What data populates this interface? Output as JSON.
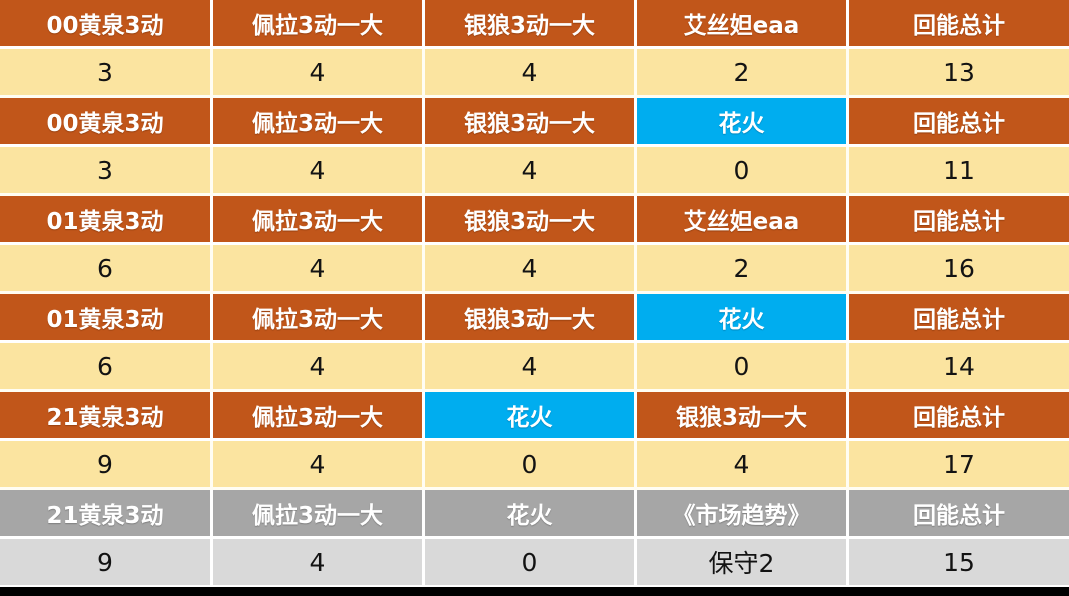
{
  "table": {
    "columns": 5,
    "colors": {
      "header_orange": "#C1561A",
      "value_yellow": "#FBE4A0",
      "header_gray": "#A6A6A6",
      "value_gray": "#D9D9D9",
      "highlight_cyan": "#00ADEF",
      "header_text": "#FFFFFF",
      "value_text": "#131313",
      "grid_line": "#FFFFFF",
      "bottom_bar": "#000000"
    },
    "rows": [
      {
        "kind": "header",
        "palette": "orange",
        "cells": [
          {
            "text": "00黄泉3动",
            "highlight": false
          },
          {
            "text": "佩拉3动一大",
            "highlight": false
          },
          {
            "text": "银狼3动一大",
            "highlight": false
          },
          {
            "text": "艾丝妲eaa",
            "highlight": false
          },
          {
            "text": "回能总计",
            "highlight": false
          }
        ]
      },
      {
        "kind": "value",
        "palette": "yellow",
        "cells": [
          {
            "text": "3",
            "highlight": false
          },
          {
            "text": "4",
            "highlight": false
          },
          {
            "text": "4",
            "highlight": false
          },
          {
            "text": "2",
            "highlight": false
          },
          {
            "text": "13",
            "highlight": false
          }
        ]
      },
      {
        "kind": "header",
        "palette": "orange",
        "cells": [
          {
            "text": "00黄泉3动",
            "highlight": false
          },
          {
            "text": "佩拉3动一大",
            "highlight": false
          },
          {
            "text": "银狼3动一大",
            "highlight": false
          },
          {
            "text": "花火",
            "highlight": true
          },
          {
            "text": "回能总计",
            "highlight": false
          }
        ]
      },
      {
        "kind": "value",
        "palette": "yellow",
        "cells": [
          {
            "text": "3",
            "highlight": false
          },
          {
            "text": "4",
            "highlight": false
          },
          {
            "text": "4",
            "highlight": false
          },
          {
            "text": "0",
            "highlight": false
          },
          {
            "text": "11",
            "highlight": false
          }
        ]
      },
      {
        "kind": "header",
        "palette": "orange",
        "cells": [
          {
            "text": "01黄泉3动",
            "highlight": false
          },
          {
            "text": "佩拉3动一大",
            "highlight": false
          },
          {
            "text": "银狼3动一大",
            "highlight": false
          },
          {
            "text": "艾丝妲eaa",
            "highlight": false
          },
          {
            "text": "回能总计",
            "highlight": false
          }
        ]
      },
      {
        "kind": "value",
        "palette": "yellow",
        "cells": [
          {
            "text": "6",
            "highlight": false
          },
          {
            "text": "4",
            "highlight": false
          },
          {
            "text": "4",
            "highlight": false
          },
          {
            "text": "2",
            "highlight": false
          },
          {
            "text": "16",
            "highlight": false
          }
        ]
      },
      {
        "kind": "header",
        "palette": "orange",
        "cells": [
          {
            "text": "01黄泉3动",
            "highlight": false
          },
          {
            "text": "佩拉3动一大",
            "highlight": false
          },
          {
            "text": "银狼3动一大",
            "highlight": false
          },
          {
            "text": "花火",
            "highlight": true
          },
          {
            "text": "回能总计",
            "highlight": false
          }
        ]
      },
      {
        "kind": "value",
        "palette": "yellow",
        "cells": [
          {
            "text": "6",
            "highlight": false
          },
          {
            "text": "4",
            "highlight": false
          },
          {
            "text": "4",
            "highlight": false
          },
          {
            "text": "0",
            "highlight": false
          },
          {
            "text": "14",
            "highlight": false
          }
        ]
      },
      {
        "kind": "header",
        "palette": "orange",
        "cells": [
          {
            "text": "21黄泉3动",
            "highlight": false
          },
          {
            "text": "佩拉3动一大",
            "highlight": false
          },
          {
            "text": "花火",
            "highlight": true
          },
          {
            "text": "银狼3动一大",
            "highlight": false
          },
          {
            "text": "回能总计",
            "highlight": false
          }
        ]
      },
      {
        "kind": "value",
        "palette": "yellow",
        "cells": [
          {
            "text": "9",
            "highlight": false
          },
          {
            "text": "4",
            "highlight": false
          },
          {
            "text": "0",
            "highlight": false
          },
          {
            "text": "4",
            "highlight": false
          },
          {
            "text": "17",
            "highlight": false
          }
        ]
      },
      {
        "kind": "header",
        "palette": "gray",
        "cells": [
          {
            "text": "21黄泉3动",
            "highlight": false
          },
          {
            "text": "佩拉3动一大",
            "highlight": false
          },
          {
            "text": "花火",
            "highlight": false
          },
          {
            "text": "《市场趋势》",
            "highlight": false
          },
          {
            "text": "回能总计",
            "highlight": false
          }
        ]
      },
      {
        "kind": "value",
        "palette": "gray",
        "cells": [
          {
            "text": "9",
            "highlight": false
          },
          {
            "text": "4",
            "highlight": false
          },
          {
            "text": "0",
            "highlight": false
          },
          {
            "text": "保守2",
            "highlight": false
          },
          {
            "text": "15",
            "highlight": false
          }
        ]
      }
    ]
  }
}
